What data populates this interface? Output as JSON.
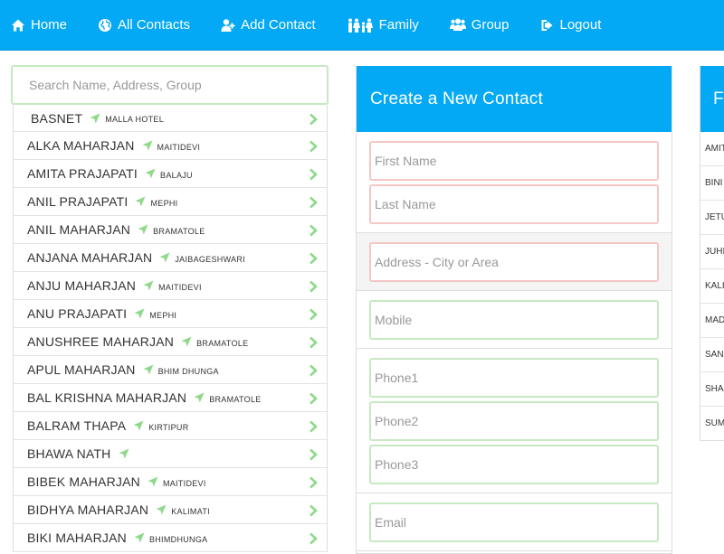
{
  "nav": {
    "items": [
      {
        "label": "Home",
        "icon": "home-icon"
      },
      {
        "label": "All Contacts",
        "icon": "globe-icon"
      },
      {
        "label": "Add Contact",
        "icon": "add-user-icon"
      },
      {
        "label": "Family",
        "icon": "family-icon"
      },
      {
        "label": "Group",
        "icon": "group-icon"
      },
      {
        "label": "Logout",
        "icon": "logout-icon"
      }
    ]
  },
  "search": {
    "placeholder": "Search Name, Address, Group"
  },
  "contacts": [
    {
      "name": "BASNET",
      "area": "MALLA HOTEL"
    },
    {
      "name": "ALKA MAHARJAN",
      "area": "MAITIDEVI"
    },
    {
      "name": "AMITA PRAJAPATI",
      "area": "BALAJU"
    },
    {
      "name": "ANIL PRAJAPATI",
      "area": "MEPHI"
    },
    {
      "name": "ANIL MAHARJAN",
      "area": "BRAMATOLE"
    },
    {
      "name": "ANJANA MAHARJAN",
      "area": "JAIBAGESHWARI"
    },
    {
      "name": "ANJU MAHARJAN",
      "area": "MAITIDEVI"
    },
    {
      "name": "ANU PRAJAPATI",
      "area": "MEPHI"
    },
    {
      "name": "ANUSHREE MAHARJAN",
      "area": "BRAMATOLE"
    },
    {
      "name": "APUL MAHARJAN",
      "area": "BHIM DHUNGA"
    },
    {
      "name": "BAL KRISHNA MAHARJAN",
      "area": "BRAMATOLE"
    },
    {
      "name": "BALRAM THAPA",
      "area": "KIRTIPUR"
    },
    {
      "name": "BHAWA NATH",
      "area": ""
    },
    {
      "name": "BIBEK MAHARJAN",
      "area": "MAITIDEVI"
    },
    {
      "name": "BIDHYA MAHARJAN",
      "area": "KALIMATI"
    },
    {
      "name": "BIKI MAHARJAN",
      "area": "BHIMDHUNGA"
    }
  ],
  "form": {
    "title": "Create a New Contact",
    "first_name_placeholder": "First Name",
    "last_name_placeholder": "Last Name",
    "address_placeholder": "Address - City or Area",
    "mobile_placeholder": "Mobile",
    "phone1_placeholder": "Phone1",
    "phone2_placeholder": "Phone2",
    "phone3_placeholder": "Phone3",
    "email_placeholder": "Email"
  },
  "family": {
    "title": "Fa",
    "items": [
      "AMIT",
      "BINI",
      "JETU",
      "JUHI",
      "KALI",
      "MAD",
      "SAN",
      "SHA",
      "SUM"
    ]
  },
  "colors": {
    "accent": "#03a9f4",
    "valid_border": "#c6e9c2",
    "invalid_border": "#f5c6c6",
    "arrow": "#8fd98a"
  }
}
